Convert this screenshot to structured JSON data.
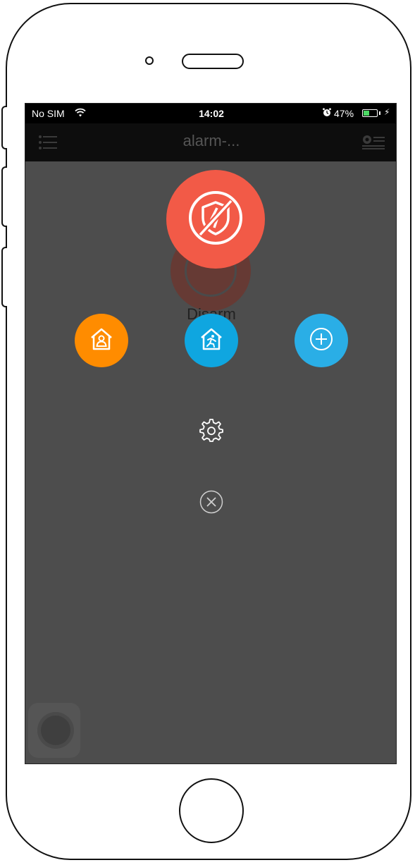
{
  "status_bar": {
    "carrier": "No SIM",
    "time": "14:02",
    "battery_percent": "47%",
    "battery_level": 0.47,
    "battery_color": "#4cd964"
  },
  "nav": {
    "title": "alarm-...",
    "left_icon": "menu-list-icon",
    "right_icon": "camera-list-icon"
  },
  "main": {
    "disarm_label": "Disarm",
    "disarm_color": "#f25a47",
    "actions": [
      {
        "name": "home-arm",
        "icon": "home-person-icon",
        "color": "#ff8c00"
      },
      {
        "name": "away-arm",
        "icon": "home-running-icon",
        "color": "#0fa6e0"
      },
      {
        "name": "add",
        "icon": "plus-icon",
        "color": "#2aaee6"
      }
    ],
    "settings_icon": "gear-icon",
    "close_icon": "close-icon"
  }
}
